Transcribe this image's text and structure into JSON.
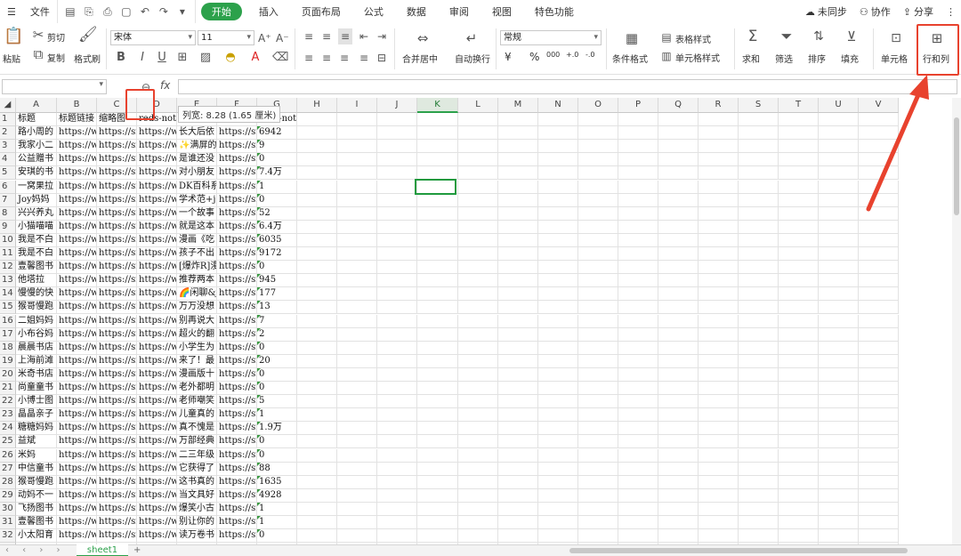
{
  "menu": {
    "file": "文件",
    "active_tab": "开始",
    "tabs": [
      "插入",
      "页面布局",
      "公式",
      "数据",
      "审阅",
      "视图",
      "特色功能"
    ],
    "right": {
      "sync": "未同步",
      "collab": "协作",
      "share": "分享"
    }
  },
  "ribbon": {
    "paste": "粘贴",
    "cut": "剪切",
    "copy": "复制",
    "format_painter": "格式刷",
    "font_name": "宋体",
    "font_size": "11",
    "bold": "B",
    "italic": "I",
    "underline": "U",
    "merge_center": "合并居中",
    "wrap_text": "自动换行",
    "number_format": "常规",
    "currency": "¥",
    "percent": "%",
    "thousands": "000",
    "inc_decimal": "+.0",
    "dec_decimal": "-.0",
    "conditional_format": "条件格式",
    "table_style": "表格样式",
    "cell_style": "单元格样式",
    "sum": "求和",
    "filter": "筛选",
    "sort": "排序",
    "fill": "填充",
    "cell": "单元格",
    "rows_cols": "行和列"
  },
  "formula_bar": {
    "fx": "fx",
    "name_box": "",
    "value": ""
  },
  "tooltip": "列宽: 8.28 (1.65 厘米)",
  "columns": [
    "A",
    "B",
    "C",
    "D",
    "E",
    "F",
    "G",
    "H",
    "I",
    "J",
    "K",
    "L",
    "M",
    "N",
    "O",
    "P",
    "Q",
    "R",
    "S",
    "T",
    "U",
    "V"
  ],
  "rows": [
    [
      "标题",
      "标题链接",
      "缩略图",
      "reds-note-reds-note",
      "",
      "文件",
      "reds-note-like-text"
    ],
    [
      "路小周的",
      "https://w",
      "https://sr",
      "https://w",
      "长大后依",
      "https://sr",
      "6942"
    ],
    [
      "我家小二",
      "https://w",
      "https://sr",
      "https://w",
      "✨满屏的",
      "https://sr",
      "9"
    ],
    [
      "公益赠书",
      "https://w",
      "https://sr",
      "https://w",
      "是谁还没",
      "https://sr",
      "0"
    ],
    [
      "安琪的书",
      "https://w",
      "https://sr",
      "https://w",
      "对小朋友",
      "https://sr",
      "7.4万"
    ],
    [
      "一窝果拉",
      "https://w",
      "https://sr",
      "https://w",
      "DK百科系",
      "https://sr",
      "1"
    ],
    [
      "Joy妈妈",
      "https://w",
      "https://sr",
      "https://w",
      "学术范+j",
      "https://sr",
      "0"
    ],
    [
      "兴兴养丸",
      "https://w",
      "https://sr",
      "https://w",
      "一个故事",
      "https://sr",
      "52"
    ],
    [
      "小猫喵喵",
      "https://w",
      "https://sr",
      "https://w",
      "就是这本",
      "https://sr",
      "6.4万"
    ],
    [
      "我是不白",
      "https://w",
      "https://sr",
      "https://w",
      "漫画《吃",
      "https://sr",
      "6035"
    ],
    [
      "我是不白",
      "https://w",
      "https://sr",
      "https://w",
      "孩子不出",
      "https://sr",
      "9172"
    ],
    [
      "壹馨图书",
      "https://w",
      "https://sr",
      "https://w",
      "[爆炸R]漫",
      "https://sr",
      "0"
    ],
    [
      "他塔拉",
      "https://w",
      "https://sr",
      "https://w",
      "推荐两本",
      "https://sr",
      "945"
    ],
    [
      "慢慢的快",
      "https://w",
      "https://sr",
      "https://w",
      "🌈闲聊&j",
      "https://sr",
      "177"
    ],
    [
      "猴哥慢跑",
      "https://w",
      "https://sr",
      "https://w",
      "万万没想",
      "https://sr",
      "13"
    ],
    [
      "二姐妈妈",
      "https://w",
      "https://sr",
      "https://w",
      "别再说大",
      "https://sr",
      "7"
    ],
    [
      "小布谷妈",
      "https://w",
      "https://sr",
      "https://w",
      "超火的翻",
      "https://sr",
      "2"
    ],
    [
      "晨晨书店",
      "https://w",
      "https://sr",
      "https://w",
      "小学生为",
      "https://sr",
      "0"
    ],
    [
      "上海前滩",
      "https://w",
      "https://sr",
      "https://w",
      "来了！最",
      "https://sr",
      "20"
    ],
    [
      "米奇书店",
      "https://w",
      "https://sr",
      "https://w",
      "漫画版十",
      "https://sr",
      "0"
    ],
    [
      "尚童童书",
      "https://w",
      "https://sr",
      "https://w",
      "老外都明",
      "https://sr",
      "0"
    ],
    [
      "小博士图",
      "https://w",
      "https://sr",
      "https://w",
      "老师嘲笑",
      "https://sr",
      "5"
    ],
    [
      "晶晶亲子",
      "https://w",
      "https://sr",
      "https://w",
      "儿童真的",
      "https://sr",
      "1"
    ],
    [
      "糖糖妈妈",
      "https://w",
      "https://sr",
      "https://w",
      "真不愧是",
      "https://sr",
      "1.9万"
    ],
    [
      "益斌",
      "https://w",
      "https://sr",
      "https://w",
      "万部经典",
      "https://sr",
      "0"
    ],
    [
      "米妈",
      "https://w",
      "https://sr",
      "https://w",
      "二三年级",
      "https://sr",
      "0"
    ],
    [
      "中信童书",
      "https://w",
      "https://sr",
      "https://w",
      "它获得了",
      "https://sr",
      "88"
    ],
    [
      "猴哥慢跑",
      "https://w",
      "https://sr",
      "https://w",
      "这书真的",
      "https://sr",
      "1635"
    ],
    [
      "动妈不一",
      "https://w",
      "https://sr",
      "https://w",
      "当文具好",
      "https://sr",
      "4928"
    ],
    [
      "飞扬图书",
      "https://w",
      "https://sr",
      "https://w",
      "爆笑小古",
      "https://sr",
      "1"
    ],
    [
      "壹馨图书",
      "https://w",
      "https://sr",
      "https://w",
      "别让你的",
      "https://sr",
      "1"
    ],
    [
      "小太阳育",
      "https://w",
      "https://sr",
      "https://w",
      "读万卷书",
      "https://sr",
      "0"
    ]
  ],
  "sheet_tab": "sheet1",
  "add_sheet": "+",
  "accent_color": "#2ca14b",
  "highlight_color": "#e8422e"
}
